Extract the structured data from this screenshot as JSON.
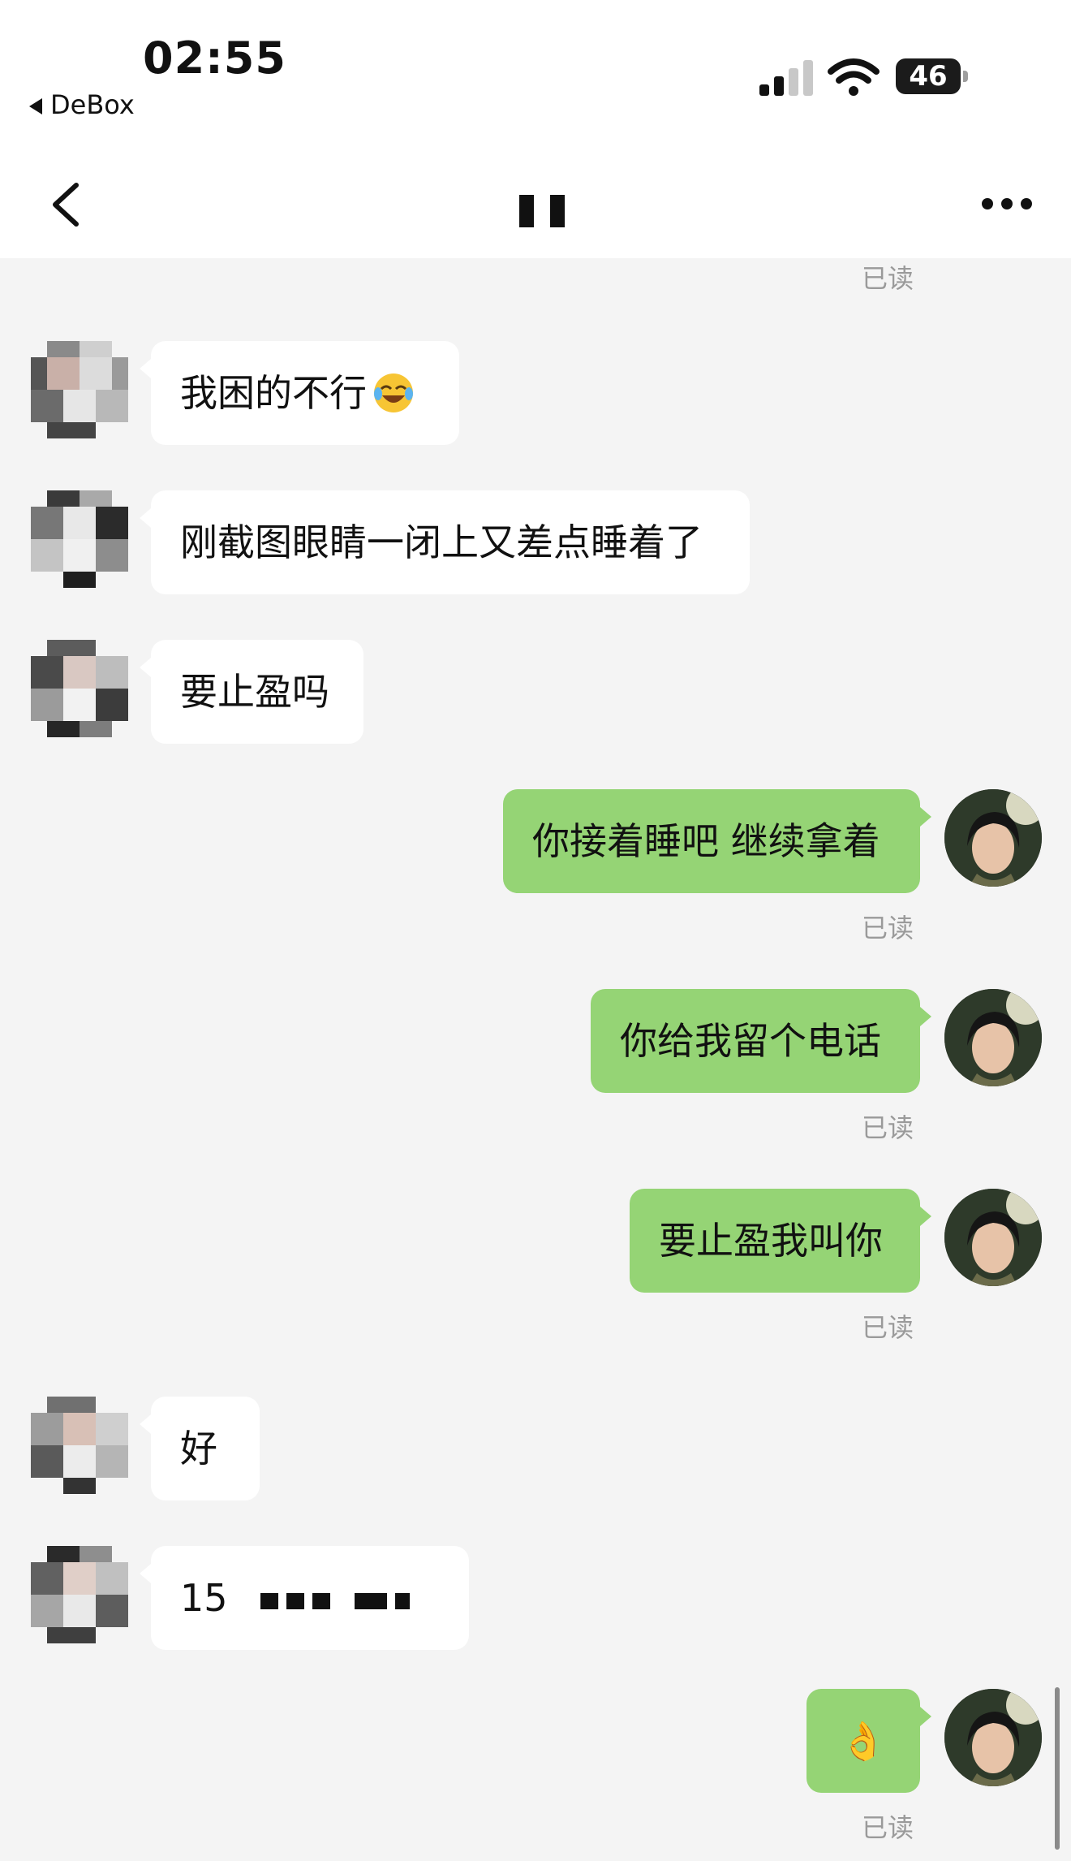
{
  "status_bar": {
    "time": "02:55",
    "back_app": "DeBox",
    "battery": "46"
  },
  "nav": {
    "title": "▮▮"
  },
  "messages": [
    {
      "side": "in",
      "text": "我困的不行",
      "emoji": "face-with-tears-of-joy"
    },
    {
      "side": "in",
      "text": "刚截图眼睛一闭上又差点睡着了"
    },
    {
      "side": "in",
      "text": "要止盈吗"
    },
    {
      "side": "out",
      "text": "你接着睡吧 继续拿着",
      "status": "已读"
    },
    {
      "side": "out",
      "text": "你给我留个电话",
      "status": "已读"
    },
    {
      "side": "out",
      "text": "要止盈我叫你",
      "status": "已读"
    },
    {
      "side": "in",
      "text": "好"
    },
    {
      "side": "in",
      "text": "15"
    },
    {
      "side": "out",
      "text": "👌",
      "status": "已读"
    }
  ],
  "top_read": "已读",
  "colors": {
    "bubble_out": "#95d475",
    "bubble_in": "#ffffff",
    "background": "#f4f4f4"
  }
}
